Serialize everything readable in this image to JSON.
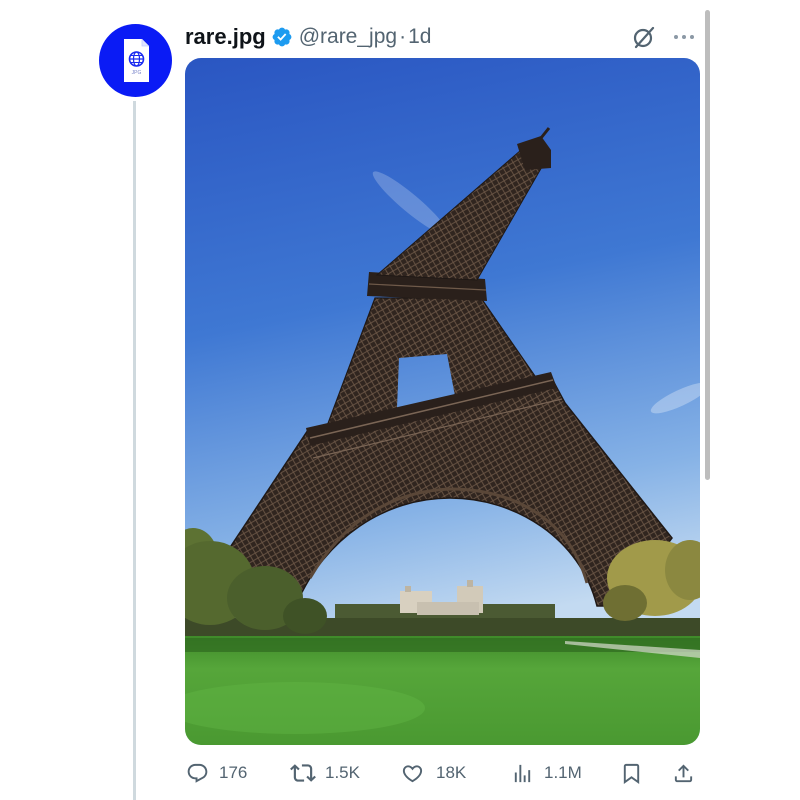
{
  "tweet": {
    "author": {
      "display_name": "rare.jpg",
      "handle": "@rare_jpg",
      "verified": true,
      "avatar_text": "JPG",
      "avatar_icon": "jpg-file-globe-icon"
    },
    "separator": "·",
    "time": "1d",
    "header_icons": [
      "grok-icon",
      "more-options-icon"
    ],
    "actions": [
      {
        "icon": "reply-icon",
        "count": "176"
      },
      {
        "icon": "retweet-icon",
        "count": "1.5K"
      },
      {
        "icon": "heart-icon",
        "count": "18K"
      },
      {
        "icon": "views-icon",
        "count": "1.1M"
      },
      {
        "icon": "bookmark-icon"
      },
      {
        "icon": "share-icon"
      }
    ]
  },
  "colors": {
    "avatar_background": "#0a1bf5",
    "verified_badge": "#1d9bf0",
    "text_primary": "#0f1419",
    "text_secondary": "#536471",
    "thread_line": "#cfd9de"
  }
}
